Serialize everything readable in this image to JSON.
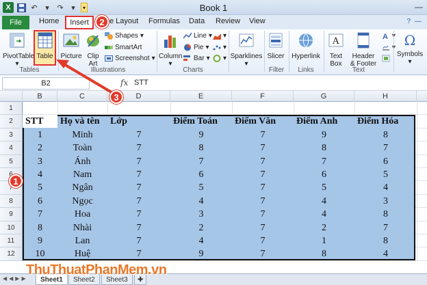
{
  "window": {
    "title": "Book 1"
  },
  "qat": {
    "icons": [
      "excel-logo",
      "save-icon",
      "undo-icon",
      "redo-icon",
      "qat-more-icon"
    ]
  },
  "tabs": {
    "file": "File",
    "home": "Home",
    "insert": "Insert",
    "page_layout": "e Layout",
    "formulas": "Formulas",
    "data": "Data",
    "review": "Review",
    "view": "View"
  },
  "ribbon": {
    "tables": {
      "pivottable": "PivotTable",
      "table": "Table",
      "label": "Tables"
    },
    "illustrations": {
      "picture": "Picture",
      "clipart_1": "Clip",
      "clipart_2": "Art",
      "shapes": "Shapes",
      "smartart": "SmartArt",
      "screenshot": "Screenshot",
      "label": "Illustrations"
    },
    "charts": {
      "column": "Column",
      "line": "Line",
      "pie": "Pie",
      "bar": "Bar",
      "label": "Charts"
    },
    "sparklines": {
      "btn": "Sparklines"
    },
    "filter": {
      "slicer": "Slicer",
      "label": "Filter"
    },
    "links": {
      "hyperlink": "Hyperlink",
      "label": "Links"
    },
    "text": {
      "textbox_1": "Text",
      "textbox_2": "Box",
      "header_1": "Header",
      "header_2": "& Footer",
      "label": "Text"
    },
    "symbols": {
      "btn": "Symbols",
      "glyph": "Ω"
    }
  },
  "formula_bar": {
    "name_box": "B2",
    "fx": "fx",
    "content": "STT"
  },
  "columns": [
    "B",
    "C",
    "D",
    "E",
    "F",
    "G",
    "H"
  ],
  "rows": [
    "1",
    "2",
    "3",
    "4",
    "5",
    "6",
    "7",
    "8",
    "9",
    "10",
    "11",
    "12"
  ],
  "table": {
    "headers": [
      "STT",
      "Họ và tên",
      "Lớp",
      "Điểm Toán",
      "Điểm Văn",
      "Điểm Anh",
      "Điểm Hóa"
    ],
    "rows": [
      [
        "1",
        "Minh",
        "7",
        "9",
        "7",
        "9",
        "8"
      ],
      [
        "2",
        "Toàn",
        "7",
        "8",
        "7",
        "8",
        "7"
      ],
      [
        "3",
        "Ánh",
        "7",
        "7",
        "7",
        "7",
        "6"
      ],
      [
        "4",
        "Nam",
        "7",
        "6",
        "7",
        "6",
        "5"
      ],
      [
        "5",
        "Ngân",
        "7",
        "5",
        "7",
        "5",
        "4"
      ],
      [
        "6",
        "Ngọc",
        "7",
        "4",
        "7",
        "4",
        "3"
      ],
      [
        "7",
        "Hoa",
        "7",
        "3",
        "7",
        "4",
        "8"
      ],
      [
        "8",
        "Nhài",
        "7",
        "2",
        "7",
        "2",
        "7"
      ],
      [
        "9",
        "Lan",
        "7",
        "4",
        "7",
        "1",
        "8"
      ],
      [
        "10",
        "Huệ",
        "7",
        "9",
        "7",
        "8",
        "4"
      ]
    ]
  },
  "sheets": [
    "Sheet1",
    "Sheet2",
    "Sheet3"
  ],
  "badges": [
    "1",
    "2",
    "3"
  ],
  "watermark": "ThuThuatPhanMem.vn",
  "colors": {
    "selection": "#a6c6e8",
    "badge": "#e23a2a",
    "file_tab": "#2a8a3e",
    "watermark": "#e8792b"
  }
}
